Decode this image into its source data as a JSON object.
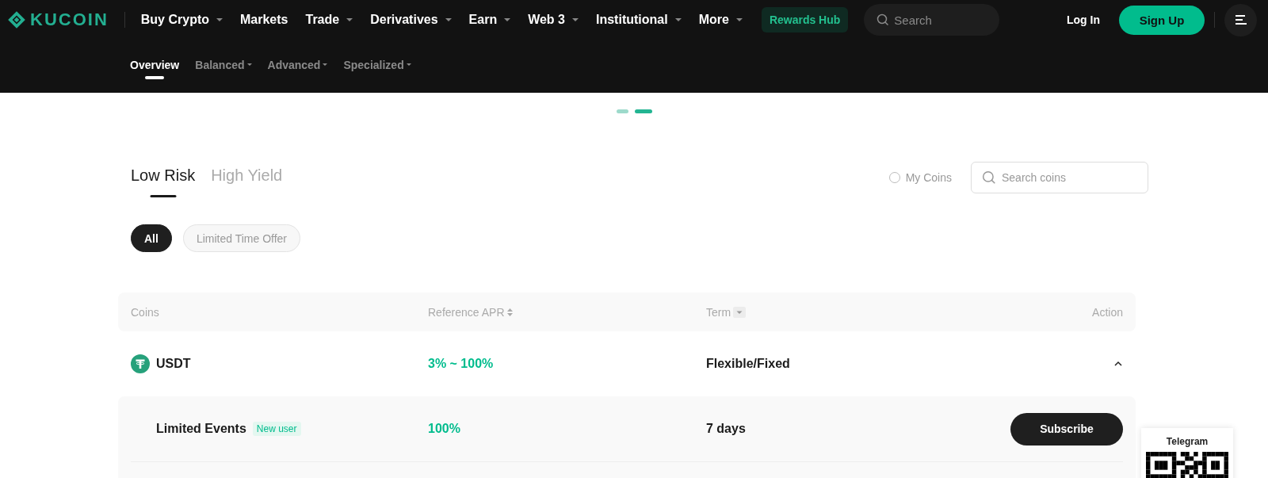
{
  "header": {
    "logo": "KUCOIN",
    "nav": [
      {
        "label": "Buy Crypto",
        "dropdown": true
      },
      {
        "label": "Markets",
        "dropdown": false
      },
      {
        "label": "Trade",
        "dropdown": true
      },
      {
        "label": "Derivatives",
        "dropdown": true
      },
      {
        "label": "Earn",
        "dropdown": true
      },
      {
        "label": "Web 3",
        "dropdown": true
      },
      {
        "label": "Institutional",
        "dropdown": true
      },
      {
        "label": "More",
        "dropdown": true
      }
    ],
    "rewards": "Rewards Hub",
    "search": {
      "placeholder": "Search"
    },
    "login": "Log In",
    "signup": "Sign Up"
  },
  "subnav": [
    {
      "label": "Overview",
      "selected": true,
      "dropdown": false
    },
    {
      "label": "Balanced",
      "selected": false,
      "dropdown": true
    },
    {
      "label": "Advanced",
      "selected": false,
      "dropdown": true
    },
    {
      "label": "Specialized",
      "selected": false,
      "dropdown": true
    }
  ],
  "carousel": [
    {
      "selected": false
    },
    {
      "selected": true
    }
  ],
  "tabs": [
    {
      "label": "Low Risk",
      "selected": true
    },
    {
      "label": "High Yield",
      "selected": false
    }
  ],
  "my_coins": {
    "label": "My Coins",
    "checked": false
  },
  "coin_search": {
    "placeholder": "Search coins"
  },
  "filters": [
    {
      "label": "All",
      "selected": true
    },
    {
      "label": "Limited Time Offer",
      "selected": false
    }
  ],
  "table": {
    "columns": [
      {
        "label": "Coins",
        "kind": "plain"
      },
      {
        "label": "Reference APR",
        "kind": "sort"
      },
      {
        "label": "Term",
        "kind": "filter"
      },
      {
        "label": "Action",
        "kind": "plain"
      }
    ],
    "rows": [
      {
        "coin": "USDT",
        "apr": "3% ~ 100%",
        "term": "Flexible/Fixed",
        "expanded": true,
        "children": [
          {
            "name": "Limited Events",
            "badge": "New user",
            "apr": "100%",
            "term": "7 days",
            "action": "Subscribe"
          }
        ]
      }
    ]
  },
  "telegram": {
    "label": "Telegram"
  }
}
